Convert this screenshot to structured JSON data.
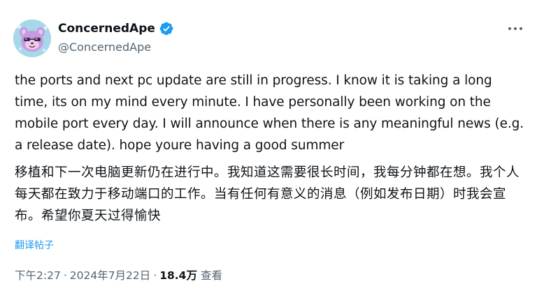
{
  "author": {
    "name": "ConcernedApe",
    "handle": "@ConcernedApe",
    "verified": true
  },
  "post": {
    "text_en": "the ports and next pc update are still in progress. I know it is taking a long time, its on my mind every minute. I have personally been working on the mobile port every day. I will announce when there is any meaningful news (e.g. a release date). hope youre having a good summer",
    "text_zh": "移植和下一次电脑更新仍在进行中。我知道这需要很长时间，我每分钟都在想。我个人每天都在致力于移动端口的工作。当有任何有意义的消息（例如发布日期）时我会宣布。希望你夏天过得愉快",
    "translate_label": "翻译帖子"
  },
  "meta": {
    "time": "下午2:27",
    "separator": "·",
    "date": "2024年7月22日",
    "views": "18.4万",
    "views_label": "查看"
  },
  "colors": {
    "text": "#0f1419",
    "secondary": "#536471",
    "accent": "#1d9bf0"
  },
  "icons": {
    "verified": "verified-badge-icon",
    "more": "more-options-icon"
  }
}
